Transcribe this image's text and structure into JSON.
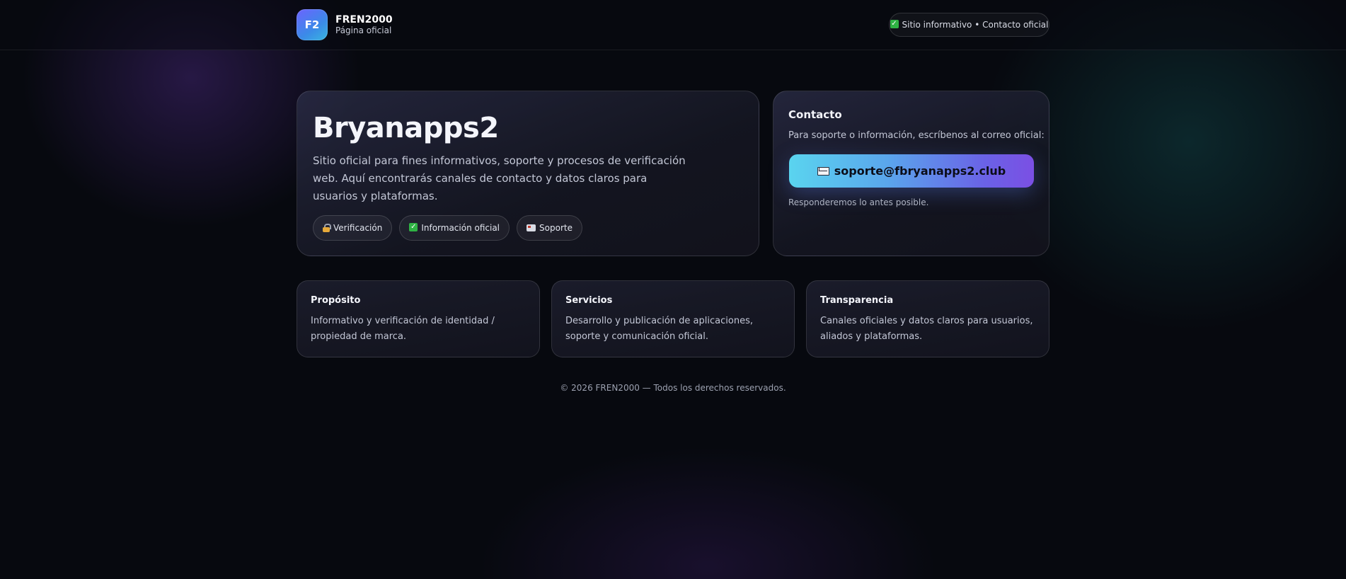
{
  "header": {
    "logo_text": "F2",
    "brand_name": "FREN2000",
    "brand_sub": "Página oficial",
    "status_pill": "Sitio informativo • Contacto oficial"
  },
  "hero": {
    "title": "Bryanapps2",
    "description": "Sitio oficial para fines informativos, soporte y procesos de verificación web. Aquí encontrarás canales de contacto y datos claros para usuarios y plataformas.",
    "chips": [
      {
        "icon": "lock-icon",
        "label": "Verificación"
      },
      {
        "icon": "check-icon",
        "label": "Información oficial"
      },
      {
        "icon": "mailbox-icon",
        "label": "Soporte"
      }
    ]
  },
  "contact": {
    "title": "Contacto",
    "description": "Para soporte o información, escríbenos al correo oficial:",
    "email": "soporte@fbryanapps2.club",
    "email_icon": "envelope-icon",
    "note": "Responderemos lo antes posible."
  },
  "info_cards": [
    {
      "title": "Propósito",
      "text": "Informativo y verificación de identidad / propiedad de marca."
    },
    {
      "title": "Servicios",
      "text": "Desarrollo y publicación de aplicaciones, soporte y comunicación oficial."
    },
    {
      "title": "Transparencia",
      "text": "Canales oficiales y datos claros para usuarios, aliados y plataformas."
    }
  ],
  "footer": {
    "text": "© 2026 FREN2000 — Todos los derechos reservados."
  },
  "colors": {
    "background": "#07090f",
    "accent_start": "#5ad4ef",
    "accent_end": "#7b4fe4",
    "check_green": "#2fb344"
  }
}
